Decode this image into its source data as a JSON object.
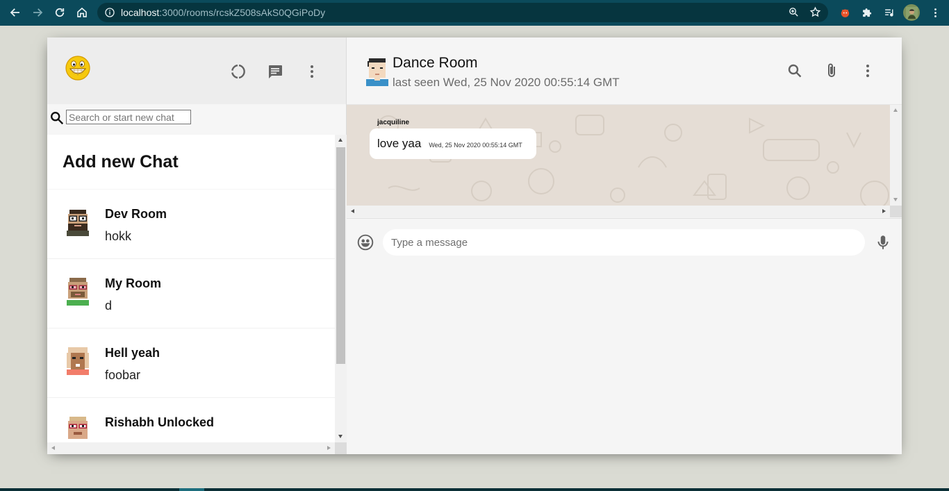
{
  "browser": {
    "url_host": "localhost",
    "url_path": ":3000/rooms/rcskZ508sAkS0QGiPoDy"
  },
  "sidebar": {
    "search_placeholder": "Search or start new chat",
    "add_chat_label": "Add new Chat",
    "chats": [
      {
        "name": "Dev Room",
        "last_message": "hokk"
      },
      {
        "name": "My Room",
        "last_message": "d"
      },
      {
        "name": "Hell yeah",
        "last_message": "foobar"
      },
      {
        "name": "Rishabh Unlocked",
        "last_message": ""
      }
    ]
  },
  "chat": {
    "room_name": "Dance Room",
    "last_seen": "last seen Wed, 25 Nov 2020 00:55:14 GMT",
    "messages": [
      {
        "sender": "jacquiline",
        "text": "love yaa",
        "timestamp": "Wed, 25 Nov 2020 00:55:14 GMT"
      }
    ],
    "input_placeholder": "Type a message"
  },
  "colors": {
    "browser_bar": "#0b4a5b",
    "app_background": "#dadbd3",
    "chat_wallpaper": "#e5ddd5",
    "icon": "#636363"
  }
}
